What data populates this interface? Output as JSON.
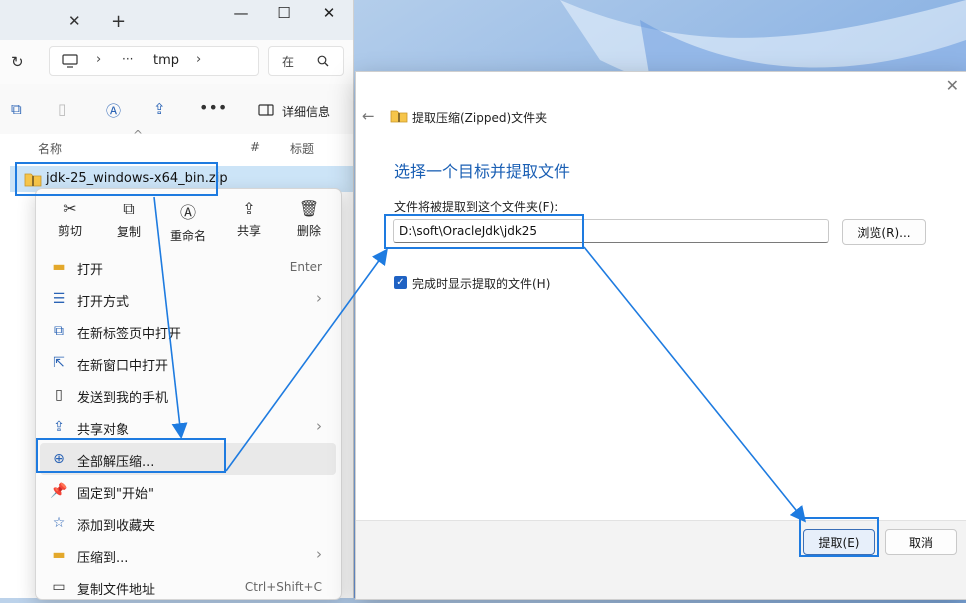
{
  "explorer": {
    "address": {
      "overflow": "···",
      "folder": "tmp"
    },
    "search": {
      "placeholder": "在"
    },
    "toolbar": {
      "details_label": "详细信息"
    },
    "columns": {
      "name": "名称",
      "number": "#",
      "title": "标题"
    },
    "file": {
      "name": "jdk-25_windows-x64_bin.zip"
    }
  },
  "context_menu": {
    "top_actions": [
      {
        "label": "剪切",
        "icon": "scissors-icon"
      },
      {
        "label": "复制",
        "icon": "copy-icon"
      },
      {
        "label": "重命名",
        "icon": "rename-icon"
      },
      {
        "label": "共享",
        "icon": "share-icon"
      },
      {
        "label": "删除",
        "icon": "trash-icon"
      }
    ],
    "items": [
      {
        "label": "打开",
        "shortcut": "Enter"
      },
      {
        "label": "打开方式"
      },
      {
        "label": "在新标签页中打开"
      },
      {
        "label": "在新窗口中打开"
      },
      {
        "label": "发送到我的手机"
      },
      {
        "label": "共享对象"
      },
      {
        "label": "全部解压缩..."
      },
      {
        "label": "固定到\"开始\""
      },
      {
        "label": "添加到收藏夹"
      },
      {
        "label": "压缩到..."
      },
      {
        "label": "复制文件地址",
        "shortcut": "Ctrl+Shift+C"
      }
    ]
  },
  "dialog": {
    "title": "提取压缩(Zipped)文件夹",
    "heading": "选择一个目标并提取文件",
    "folder_label": "文件将被提取到这个文件夹(F):",
    "path_value": "D:\\soft\\OracleJdk\\jdk25",
    "browse_label": "浏览(R)...",
    "show_files_label": "完成时显示提取的文件(H)",
    "extract_label": "提取(E)",
    "cancel_label": "取消"
  },
  "colors": {
    "accent": "#1e7be0",
    "heading": "#1a5fb4",
    "selection": "#cce4f7"
  }
}
